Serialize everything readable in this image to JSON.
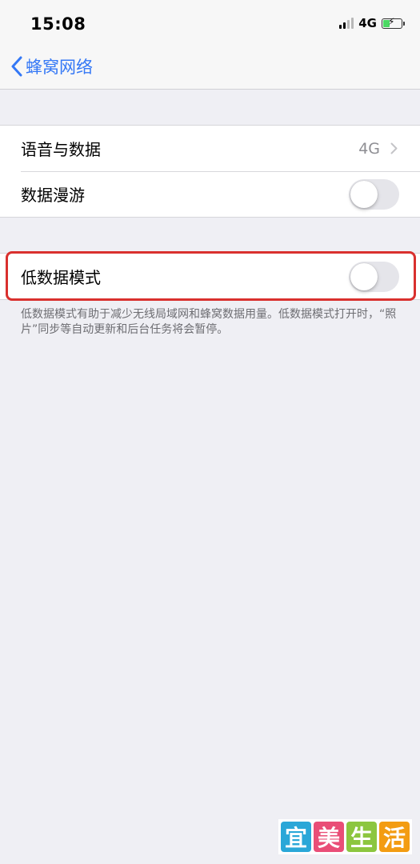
{
  "status_bar": {
    "time": "15:08",
    "network": "4G",
    "signal_bars_active": 2,
    "signal_bars_total": 4,
    "battery_icon": "battery-charging-icon",
    "battery_color": "#4cd964",
    "battery_level": 0.4
  },
  "nav": {
    "back_label": "蜂窝网络",
    "back_icon": "chevron-left-icon",
    "accent_color": "#3478f6"
  },
  "group1": {
    "voice_data_label": "语音与数据",
    "voice_data_value": "4G",
    "roaming_label": "数据漫游",
    "roaming_enabled": false
  },
  "group2": {
    "low_data_label": "低数据模式",
    "low_data_enabled": false,
    "highlight_color": "#d9302e",
    "footer": "低数据模式有助于减少无线局域网和蜂窝数据用量。低数据模式打开时，“照片”同步等自动更新和后台任务将会暂停。"
  },
  "watermark": {
    "chars": [
      "宜",
      "美",
      "生",
      "活"
    ],
    "colors": [
      "#2aa7d8",
      "#e94e77",
      "#8cc63f",
      "#f39c12"
    ]
  }
}
